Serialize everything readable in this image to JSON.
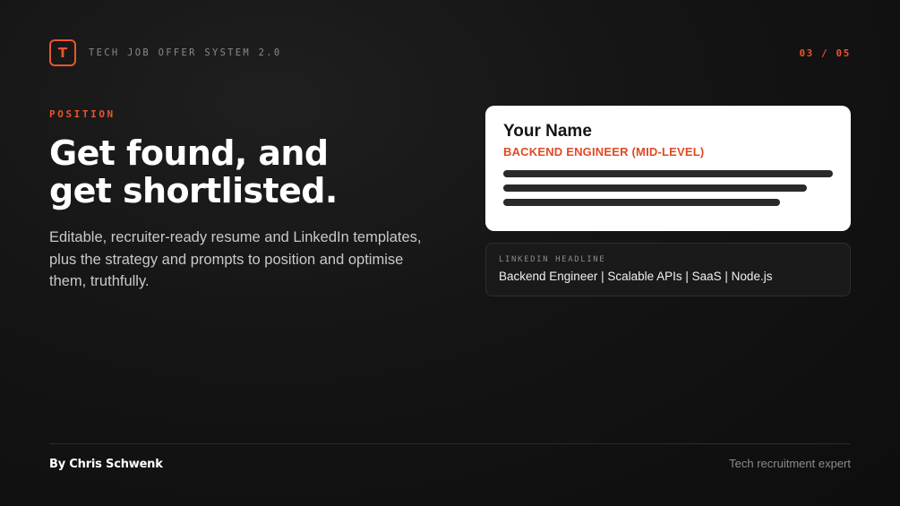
{
  "header": {
    "logo_letter": "T",
    "brand_title": "TECH JOB OFFER SYSTEM 2.0",
    "page_counter": "03 / 05"
  },
  "hero": {
    "eyebrow": "POSITION",
    "headline_line1": "Get found, and",
    "headline_line2": "get shortlisted.",
    "description": "Editable, recruiter-ready resume and LinkedIn templates, plus the strategy and prompts to position and optimise them, truthfully."
  },
  "resume_card": {
    "name": "Your Name",
    "role": "BACKEND ENGINEER (MID-LEVEL)"
  },
  "linkedin_card": {
    "label": "LINKEDIN HEADLINE",
    "headline": "Backend Engineer | Scalable APIs | SaaS | Node.js"
  },
  "footer": {
    "author": "By Chris Schwenk",
    "tagline": "Tech recruitment expert"
  },
  "colors": {
    "accent": "#e8552f",
    "background": "#121212",
    "card": "#ffffff"
  }
}
